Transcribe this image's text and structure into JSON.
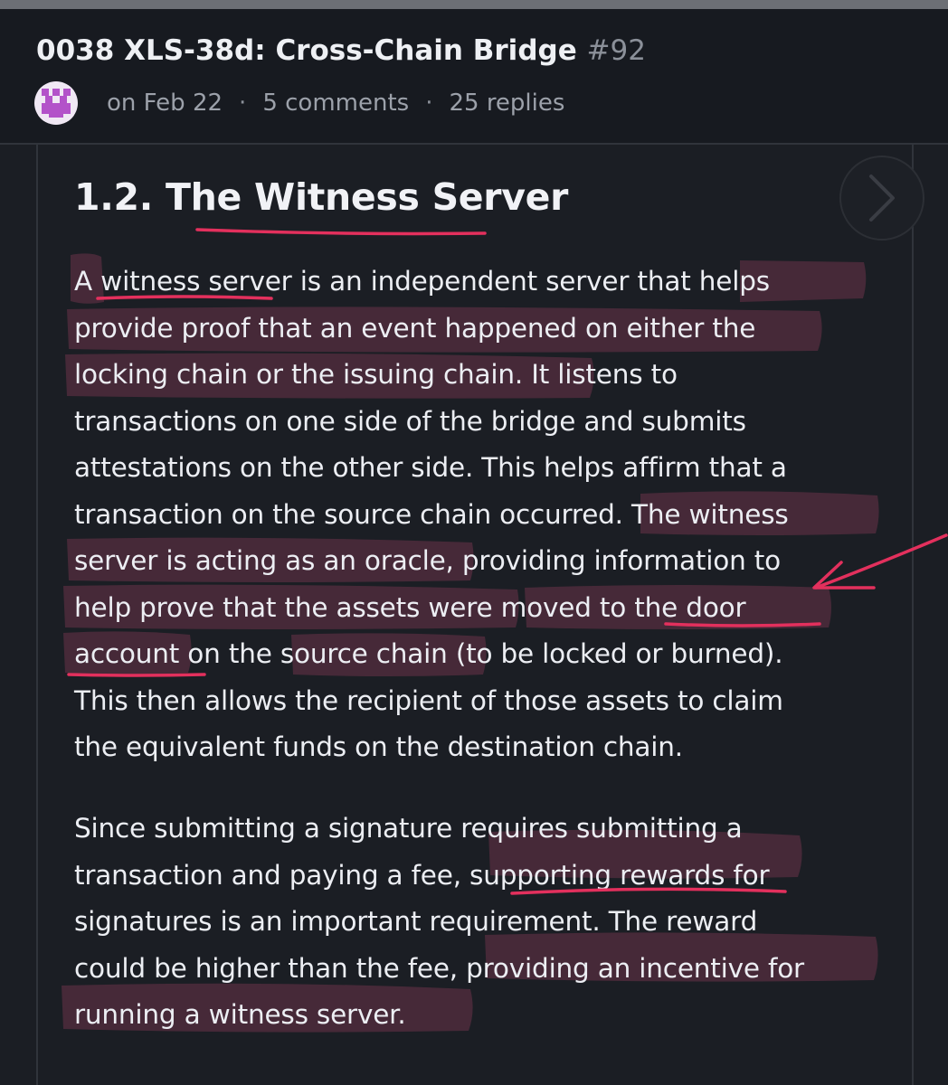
{
  "header": {
    "title": "0038 XLS-38d: Cross-Chain Bridge",
    "number": "#92",
    "date": "on Feb 22",
    "separator": "·",
    "comments": "5 comments",
    "replies": "25 replies"
  },
  "icons": {
    "avatar": "pixel-avatar-icon",
    "next": "chevron-right-icon"
  },
  "article": {
    "heading": "1.2. The Witness Server",
    "paragraph1_lines": [
      "A witness server is an independent server that helps",
      "provide proof that an event happened on either the",
      "locking chain or the issuing chain. It listens to",
      "transactions on one side of the bridge and submits",
      "attestations on the other side. This helps affirm that a",
      "transaction on the source chain occurred. The witness",
      "server is acting as an oracle, providing information to",
      "help prove that the assets were moved to the door",
      "account on the source chain (to be locked or burned).",
      "This then allows the recipient of those assets to claim",
      "the equivalent funds on the destination chain."
    ],
    "paragraph2_lines": [
      "Since submitting a signature requires submitting a",
      "transaction and paying a fee, supporting rewards for",
      "signatures is an important requirement. The reward",
      "could be higher than the fee, providing an incentive for",
      "running a witness server."
    ]
  },
  "colors": {
    "background": "#1b1e24",
    "header_background": "#171a20",
    "text": "#eceef3",
    "muted_text": "#9ca1aa",
    "highlight": "#e0507e",
    "underline": "#e3305d"
  }
}
